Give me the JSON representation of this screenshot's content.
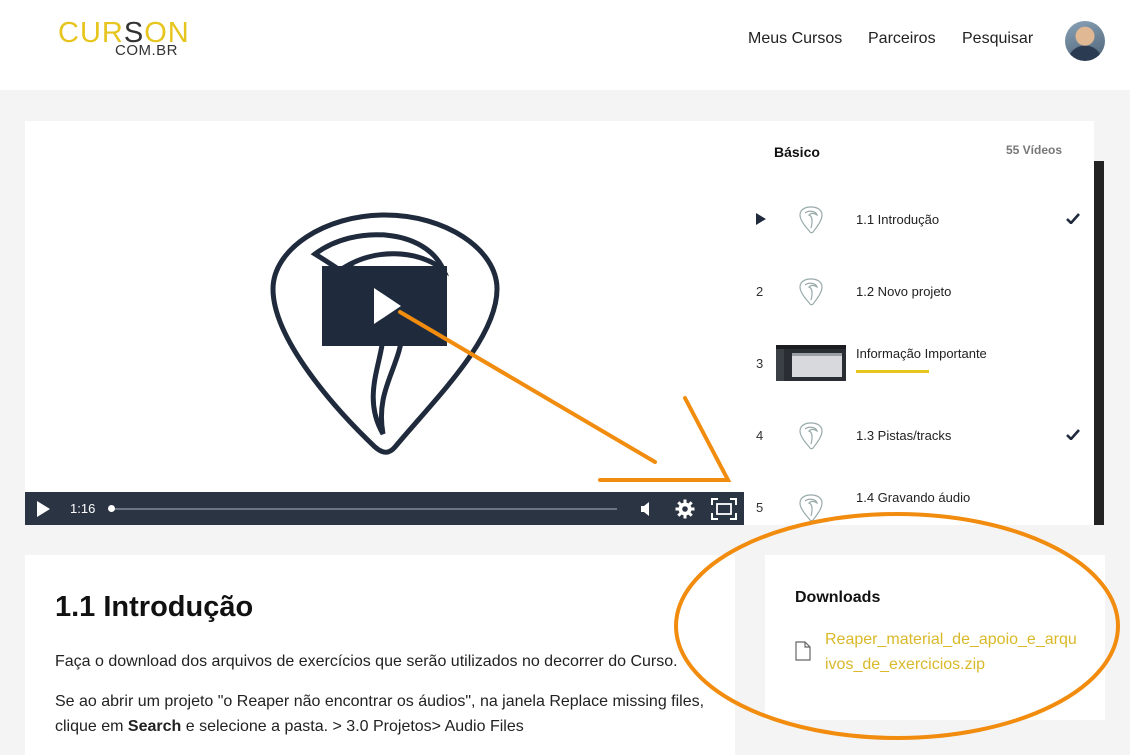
{
  "header": {
    "logo_main": "CURSON",
    "logo_sub": "COM.BR",
    "nav": [
      "Meus Cursos",
      "Parceiros",
      "Pesquisar"
    ],
    "avatar_icon": "user-avatar"
  },
  "player": {
    "time": "1:16",
    "progress": 0.0,
    "icons": [
      "play-icon",
      "volume-icon",
      "settings-gear-icon",
      "fullscreen-icon"
    ]
  },
  "playlist": {
    "title": "Básico",
    "count": "55 Vídeos",
    "items": [
      {
        "num": "",
        "label": "1.1 Introdução",
        "completed": true,
        "current": true
      },
      {
        "num": "2",
        "label": "1.2 Novo projeto",
        "completed": false
      },
      {
        "num": "3",
        "label": "Informação Importante",
        "completed": false
      },
      {
        "num": "4",
        "label": "1.3 Pistas/tracks",
        "completed": true
      },
      {
        "num": "5",
        "label": "1.4 Gravando áudio",
        "completed": false
      }
    ]
  },
  "lesson": {
    "title": "1.1 Introdução",
    "p1": "Faça o download dos arquivos de exercícios que serão utilizados no decorrer do Curso.",
    "p2_a": "Se ao abrir um projeto \"o Reaper não encontrar os áudios\", na janela Replace missing files, clique em ",
    "p2_bold": "Search",
    "p2_b": " e selecione a pasta. > 3.0 Projetos> Audio Files"
  },
  "downloads": {
    "title": "Downloads",
    "file": "Reaper_material_de_apoio_e_arquivos_de_exercicios.zip"
  },
  "colors": {
    "accent": "#e7c51f",
    "annotation": "#f28c0f",
    "player_bar": "#2b3443"
  }
}
